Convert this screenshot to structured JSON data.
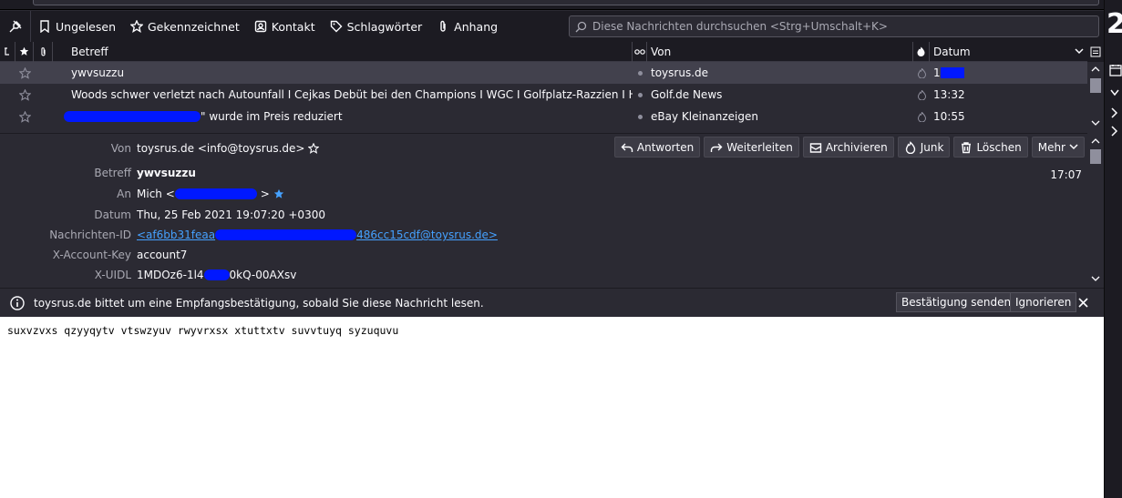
{
  "quick_filter": {
    "unread": "Ungelesen",
    "starred": "Gekennzeichnet",
    "contact": "Kontakt",
    "tags": "Schlagwörter",
    "attachment": "Anhang",
    "search_placeholder": "Diese Nachrichten durchsuchen <Strg+Umschalt+K>"
  },
  "thread_columns": {
    "subject": "Betreff",
    "from": "Von",
    "date": "Datum"
  },
  "threads": [
    {
      "subject": "ywvsuzzu",
      "from": "toysrus.de",
      "date": "1",
      "selected": true
    },
    {
      "subject": "Woods schwer verletzt nach Autounfall I Cejkas Debüt bei den Champions I WGC I Golfplatz-Razzien I Hamburg To...",
      "from": "Golf.de News",
      "date": "13:32",
      "selected": false
    },
    {
      "subject": "\" wurde im Preis reduziert",
      "from": "eBay Kleinanzeigen",
      "date": "10:55",
      "selected": false
    }
  ],
  "message": {
    "labels": {
      "from": "Von",
      "subject": "Betreff",
      "to": "An",
      "date": "Datum",
      "message_id": "Nachrichten-ID",
      "account_key": "X-Account-Key",
      "uidl": "X-UIDL"
    },
    "from": "toysrus.de <info@toysrus.de>",
    "subject": "ywvsuzzu",
    "to_prefix": "Mich <",
    "to_suffix": ">",
    "date": "Thu, 25 Feb 2021 19:07:20 +0300",
    "message_id_start": "<af6bb31feaa",
    "message_id_end": "486cc15cdf@toysrus.de>",
    "account_key": "account7",
    "uidl_start": "1MDOz6-1l4",
    "uidl_end": "0kQ-00AXsv",
    "time": "17:07"
  },
  "actions": {
    "reply": "Antworten",
    "forward": "Weiterleiten",
    "archive": "Archivieren",
    "junk": "Junk",
    "delete": "Löschen",
    "more": "Mehr"
  },
  "mdn": {
    "text": "toysrus.de bittet um eine Empfangsbestätigung, sobald Sie diese Nachricht lesen.",
    "send": "Bestätigung senden",
    "ignore": "Ignorieren"
  },
  "body_text": "suxvzvxs qzyyqytv vtswzyuv rwyvrxsx xtuttxtv suvvtuyq syzuquvu",
  "right_strip_number": "2"
}
